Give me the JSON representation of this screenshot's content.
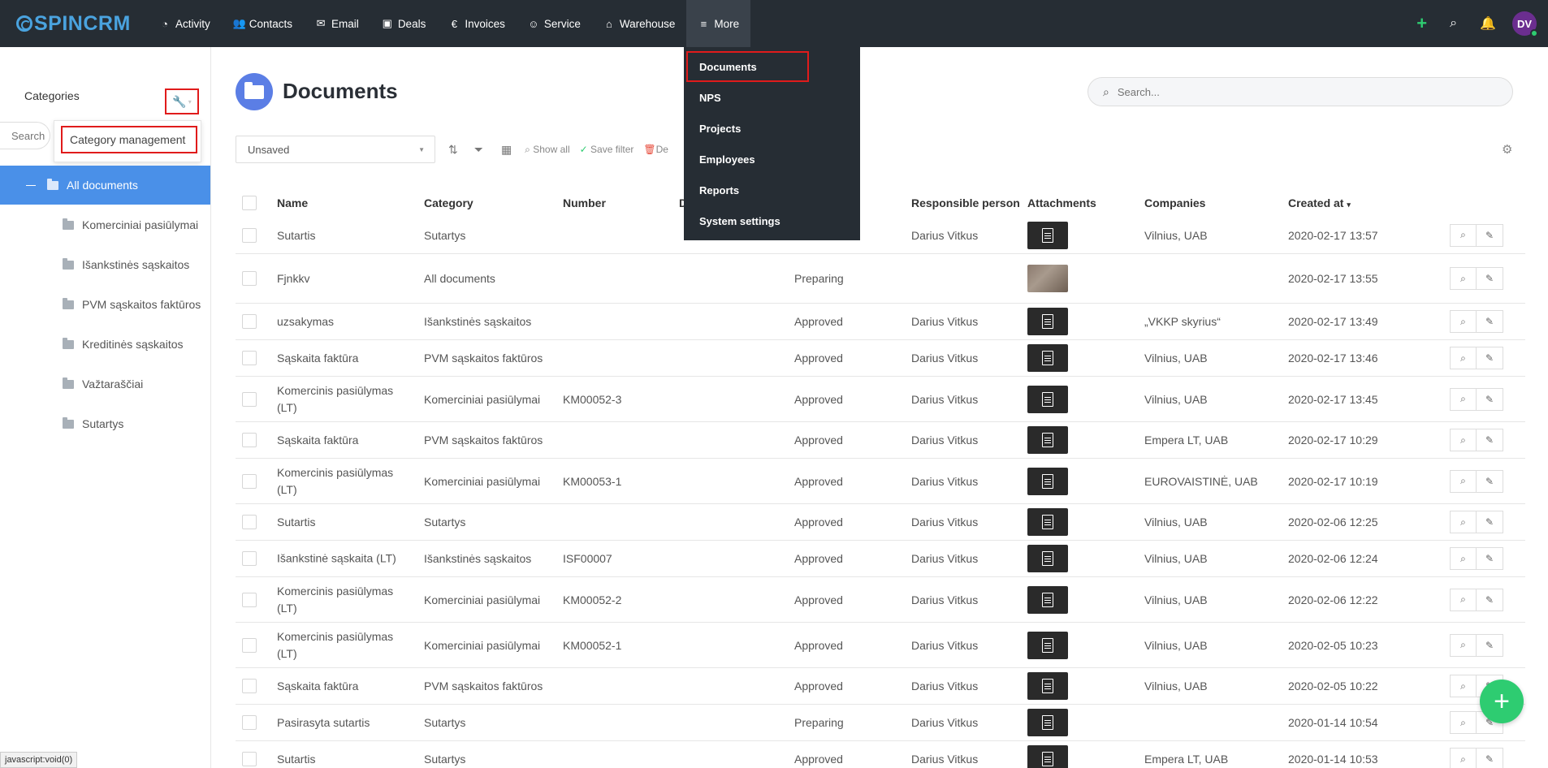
{
  "brand": {
    "logo_text": "SPINCRM",
    "accent": "#4aa3df"
  },
  "nav": {
    "items": [
      {
        "label": "Activity",
        "icon": "gauge-icon"
      },
      {
        "label": "Contacts",
        "icon": "users-icon"
      },
      {
        "label": "Email",
        "icon": "envelope-icon"
      },
      {
        "label": "Deals",
        "icon": "briefcase-icon"
      },
      {
        "label": "Invoices",
        "icon": "euro-icon"
      },
      {
        "label": "Service",
        "icon": "user-tie-icon"
      },
      {
        "label": "Warehouse",
        "icon": "warehouse-icon"
      },
      {
        "label": "More",
        "icon": "menu-icon"
      }
    ],
    "avatar_initials": "DV"
  },
  "more_menu": {
    "items": [
      "Documents",
      "NPS",
      "Projects",
      "Employees",
      "Reports",
      "System settings"
    ]
  },
  "sidebar": {
    "title": "Categories",
    "search_placeholder": "Search",
    "category_management": "Category management",
    "all_documents": "All documents",
    "categories": [
      "Komerciniai pasiūlymai",
      "Išankstinės sąskaitos",
      "PVM sąskaitos faktūros",
      "Kreditinės sąskaitos",
      "Važtaraščiai",
      "Sutartys"
    ]
  },
  "main": {
    "title": "Documents",
    "search_placeholder": "Search..."
  },
  "toolbar": {
    "filter_value": "Unsaved",
    "show_all": "Show all",
    "save_filter": "Save filter",
    "delete": "De"
  },
  "table": {
    "headers": {
      "name": "Name",
      "category": "Category",
      "number": "Number",
      "d": "D",
      "responsible": "Responsible person",
      "attachments": "Attachments",
      "companies": "Companies",
      "created": "Created at"
    },
    "rows": [
      {
        "name": "Sutartis",
        "category": "Sutartys",
        "number": "",
        "status": "",
        "person": "Darius Vitkus",
        "att": "doc",
        "company": "Vilnius, UAB",
        "created": "2020-02-17 13:57"
      },
      {
        "name": "Fjnkkv",
        "category": "All documents",
        "number": "",
        "status": "Preparing",
        "person": "",
        "att": "photo",
        "company": "",
        "created": "2020-02-17 13:55"
      },
      {
        "name": "uzsakymas",
        "category": "Išankstinės sąskaitos",
        "number": "",
        "status": "Approved",
        "person": "Darius Vitkus",
        "att": "doc",
        "company": "„VKKP skyrius“",
        "created": "2020-02-17 13:49"
      },
      {
        "name": "Sąskaita faktūra",
        "category": "PVM sąskaitos faktūros",
        "number": "",
        "status": "Approved",
        "person": "Darius Vitkus",
        "att": "doc",
        "company": "Vilnius, UAB",
        "created": "2020-02-17 13:46"
      },
      {
        "name": "Komercinis pasiūlymas (LT)",
        "category": "Komerciniai pasiūlymai",
        "number": "KM00052-3",
        "status": "Approved",
        "person": "Darius Vitkus",
        "att": "doc",
        "company": "Vilnius, UAB",
        "created": "2020-02-17 13:45"
      },
      {
        "name": "Sąskaita faktūra",
        "category": "PVM sąskaitos faktūros",
        "number": "",
        "status": "Approved",
        "person": "Darius Vitkus",
        "att": "doc",
        "company": "Empera LT, UAB",
        "created": "2020-02-17 10:29"
      },
      {
        "name": "Komercinis pasiūlymas (LT)",
        "category": "Komerciniai pasiūlymai",
        "number": "KM00053-1",
        "status": "Approved",
        "person": "Darius Vitkus",
        "att": "doc",
        "company": "EUROVAISTINĖ, UAB",
        "created": "2020-02-17 10:19"
      },
      {
        "name": "Sutartis",
        "category": "Sutartys",
        "number": "",
        "status": "Approved",
        "person": "Darius Vitkus",
        "att": "doc",
        "company": "Vilnius, UAB",
        "created": "2020-02-06 12:25"
      },
      {
        "name": "Išankstinė sąskaita (LT)",
        "category": "Išankstinės sąskaitos",
        "number": "ISF00007",
        "status": "Approved",
        "person": "Darius Vitkus",
        "att": "doc",
        "company": "Vilnius, UAB",
        "created": "2020-02-06 12:24"
      },
      {
        "name": "Komercinis pasiūlymas (LT)",
        "category": "Komerciniai pasiūlymai",
        "number": "KM00052-2",
        "status": "Approved",
        "person": "Darius Vitkus",
        "att": "doc",
        "company": "Vilnius, UAB",
        "created": "2020-02-06 12:22"
      },
      {
        "name": "Komercinis pasiūlymas (LT)",
        "category": "Komerciniai pasiūlymai",
        "number": "KM00052-1",
        "status": "Approved",
        "person": "Darius Vitkus",
        "att": "doc",
        "company": "Vilnius, UAB",
        "created": "2020-02-05 10:23"
      },
      {
        "name": "Sąskaita faktūra",
        "category": "PVM sąskaitos faktūros",
        "number": "",
        "status": "Approved",
        "person": "Darius Vitkus",
        "att": "doc",
        "company": "Vilnius, UAB",
        "created": "2020-02-05 10:22"
      },
      {
        "name": "Pasirasyta sutartis",
        "category": "Sutartys",
        "number": "",
        "status": "Preparing",
        "person": "Darius Vitkus",
        "att": "doc",
        "company": "",
        "created": "2020-01-14 10:54"
      },
      {
        "name": "Sutartis",
        "category": "Sutartys",
        "number": "",
        "status": "Approved",
        "person": "Darius Vitkus",
        "att": "doc",
        "company": "Empera LT, UAB",
        "created": "2020-01-14 10:53"
      }
    ]
  },
  "statusbar": {
    "text": "javascript:void(0)"
  }
}
